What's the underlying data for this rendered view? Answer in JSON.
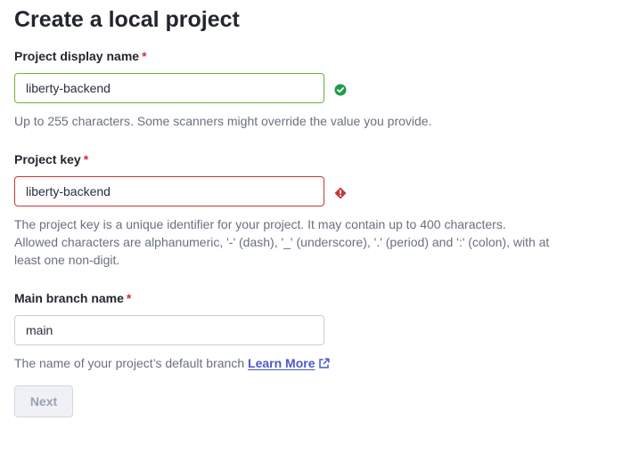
{
  "page": {
    "title": "Create a local project"
  },
  "display_name": {
    "label": "Project display name",
    "required_mark": "*",
    "value": "liberty-backend",
    "status": "valid",
    "status_icon": "check-circle-icon",
    "help": "Up to 255 characters. Some scanners might override the value you provide."
  },
  "project_key": {
    "label": "Project key",
    "required_mark": "*",
    "value": "liberty-backend",
    "status": "invalid",
    "status_icon": "error-diamond-icon",
    "help_line1": "The project key is a unique identifier for your project. It may contain up to 400 characters.",
    "help_line2": "Allowed characters are alphanumeric, '-' (dash), '_' (underscore), '.' (period) and ':' (colon), with at",
    "help_line3": "least one non-digit."
  },
  "main_branch": {
    "label": "Main branch name",
    "required_mark": "*",
    "value": "main",
    "help": "The name of your project’s default branch",
    "link_label": "Learn More",
    "link_icon": "external-link-icon"
  },
  "actions": {
    "next_label": "Next",
    "next_disabled": true
  },
  "colors": {
    "valid": "#6db33f",
    "valid_icon": "#1e9c4b",
    "invalid": "#c1393a",
    "link": "#4c59c7",
    "required": "#d02f3a"
  }
}
